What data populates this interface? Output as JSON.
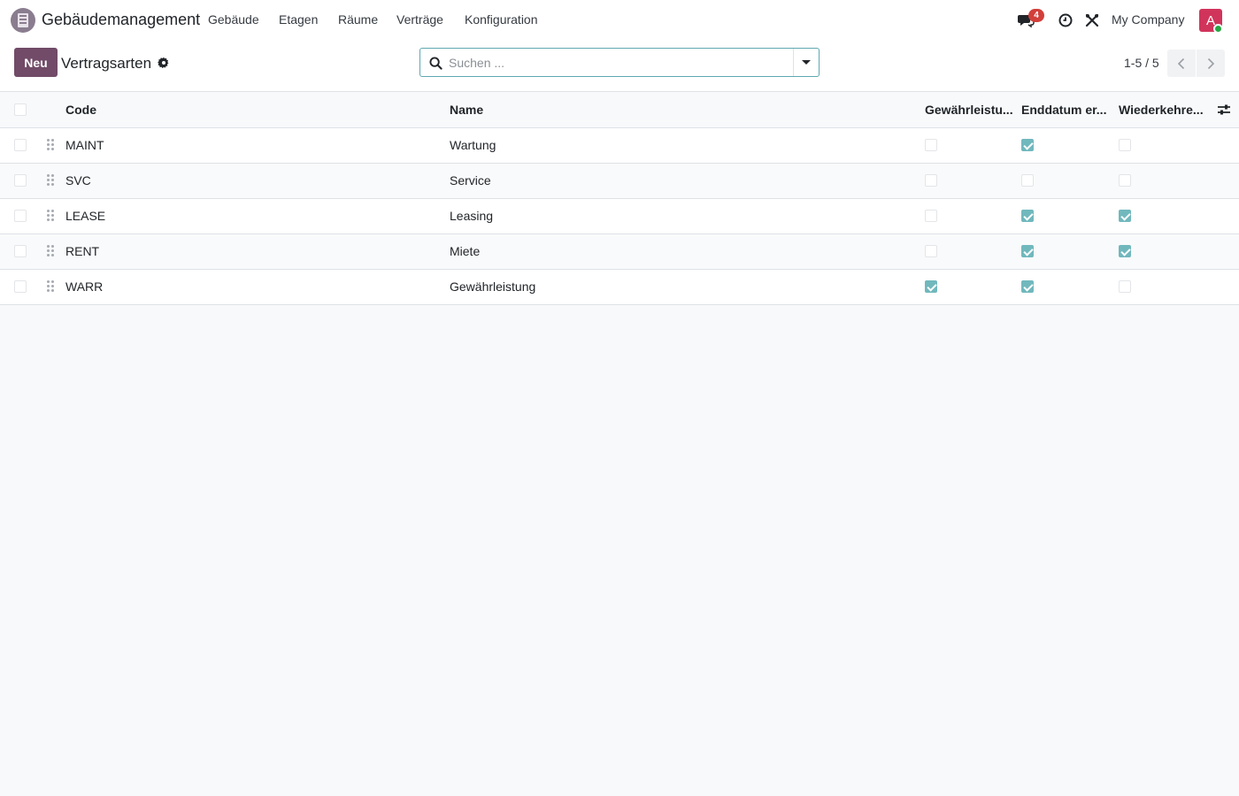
{
  "app": {
    "title": "Gebäudemanagement",
    "menu": [
      "Gebäude",
      "Etagen",
      "Räume",
      "Verträge",
      "Konfiguration"
    ]
  },
  "systray": {
    "messages_count": "4",
    "company": "My Company",
    "avatar_initial": "A"
  },
  "control": {
    "new_label": "Neu",
    "breadcrumb": "Vertragsarten",
    "search_placeholder": "Suchen ...",
    "pager": "1-5 / 5"
  },
  "table": {
    "columns": {
      "code": "Code",
      "name": "Name",
      "warranty": "Gewährleistu...",
      "enddate": "Enddatum er...",
      "recurring": "Wiederkehre..."
    },
    "rows": [
      {
        "code": "MAINT",
        "name": "Wartung",
        "warranty": false,
        "enddate": true,
        "recurring": false
      },
      {
        "code": "SVC",
        "name": "Service",
        "warranty": false,
        "enddate": false,
        "recurring": false
      },
      {
        "code": "LEASE",
        "name": "Leasing",
        "warranty": false,
        "enddate": true,
        "recurring": true
      },
      {
        "code": "RENT",
        "name": "Miete",
        "warranty": false,
        "enddate": true,
        "recurring": true
      },
      {
        "code": "WARR",
        "name": "Gewährleistung",
        "warranty": true,
        "enddate": true,
        "recurring": false
      }
    ]
  },
  "colors": {
    "brand": "#714b67",
    "checkbox_checked": "#71b8bd",
    "badge": "#d23f3a",
    "avatar": "#d1345b"
  }
}
